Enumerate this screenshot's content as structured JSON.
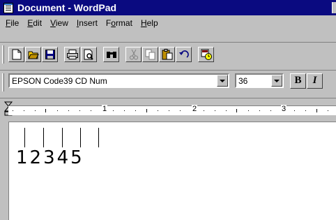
{
  "window": {
    "title": "Document - WordPad"
  },
  "menu": [
    {
      "u": "F",
      "rest": "ile"
    },
    {
      "u": "E",
      "rest": "dit"
    },
    {
      "u": "V",
      "rest": "iew"
    },
    {
      "u": "I",
      "rest": "nsert"
    },
    {
      "pre": "F",
      "u": "o",
      "rest": "rmat"
    },
    {
      "u": "H",
      "rest": "elp"
    }
  ],
  "format": {
    "font_name": "EPSON Code39 CD Num",
    "font_size": "36",
    "bold_label": "B",
    "italic_label": "I"
  },
  "ruler": {
    "labels": [
      "1",
      "2",
      "3"
    ]
  },
  "document": {
    "barcode_text": "12345"
  },
  "colors": {
    "titlebar": "#0a0a80",
    "face": "#c0c0c0"
  }
}
